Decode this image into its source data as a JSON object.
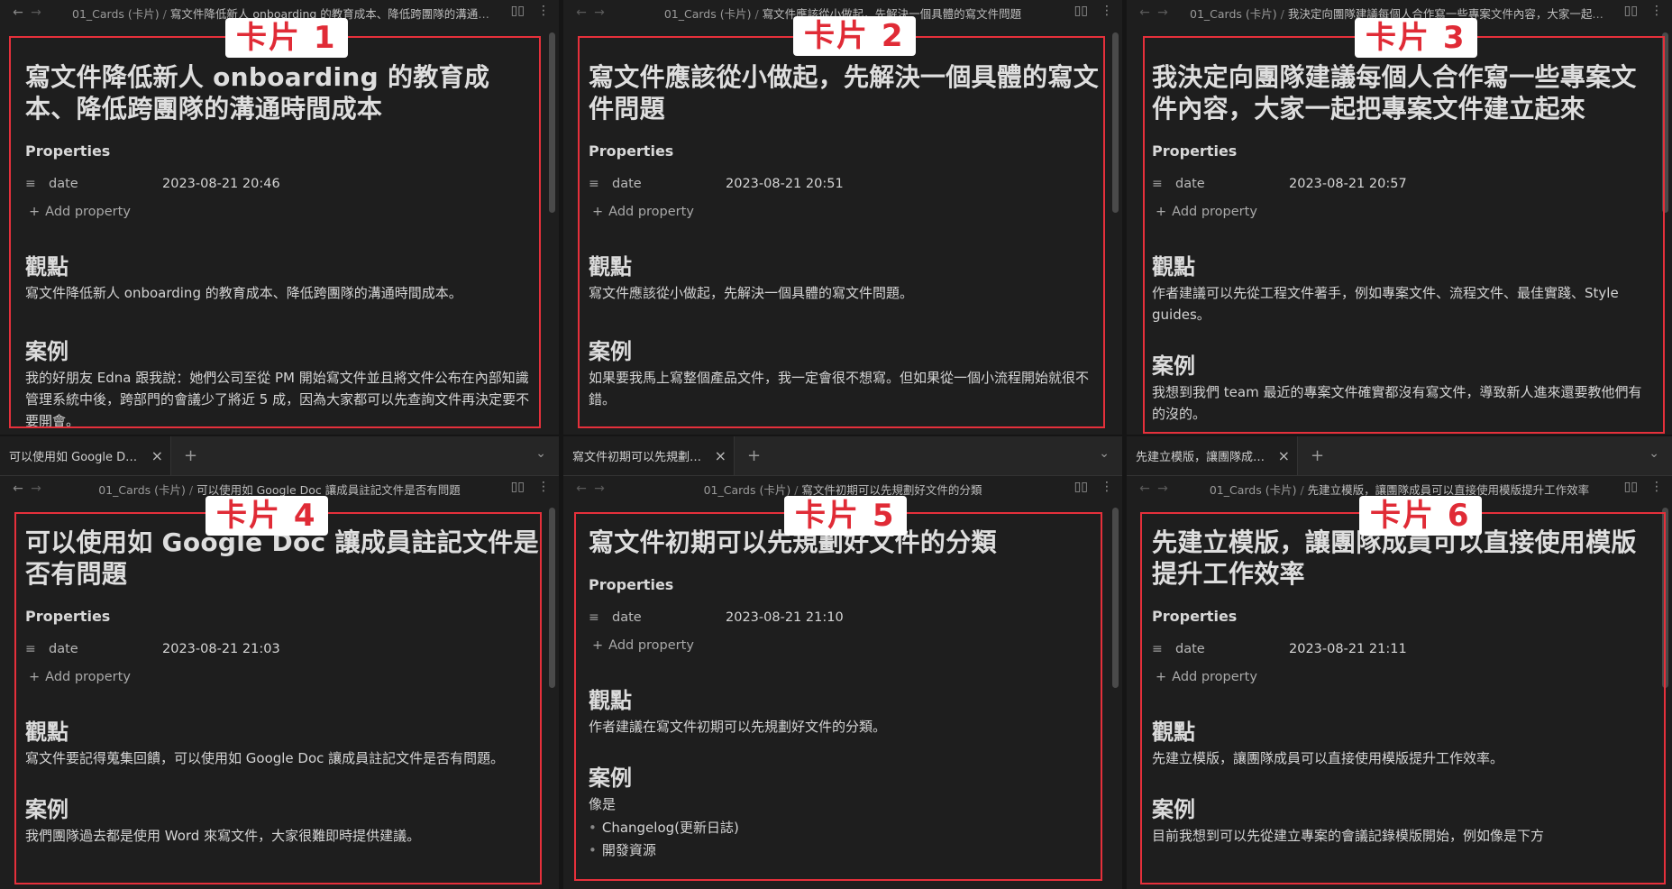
{
  "labels": {
    "properties": "Properties",
    "date_key": "date",
    "add_property": "Add property",
    "viewpoint": "觀點",
    "example": "案例"
  },
  "folder": "01_Cards (卡片)",
  "panes": [
    {
      "card_label": "卡片 1",
      "breadcrumb_file": "寫文件降低新人 onboarding 的教育成本、降低跨團隊的溝通時間成本",
      "title": "寫文件降低新人 onboarding 的教育成本、降低跨團隊的溝通時間成本",
      "date": "2023-08-21 20:46",
      "viewpoint": "寫文件降低新人 onboarding 的教育成本、降低跨團隊的溝通時間成本。",
      "example": "我的好朋友 Edna 跟我說：她們公司至從 PM 開始寫文件並且將文件公布在內部知識管理系統中後，跨部門的會議少了將近 5 成，因為大家都可以先查詢文件再決定要不要開會。"
    },
    {
      "card_label": "卡片 2",
      "breadcrumb_file": "寫文件應該從小做起，先解決一個具體的寫文件問題",
      "title": "寫文件應該從小做起，先解決一個具體的寫文件問題",
      "date": "2023-08-21 20:51",
      "viewpoint": "寫文件應該從小做起，先解決一個具體的寫文件問題。",
      "example": "如果要我馬上寫整個產品文件，我一定會很不想寫。但如果從一個小流程開始就很不錯。"
    },
    {
      "card_label": "卡片 3",
      "breadcrumb_file": "我決定向團隊建議每個人合作寫一些專案文件內容，大家一起把專案文件建立起來",
      "title": "我決定向團隊建議每個人合作寫一些專案文件內容，大家一起把專案文件建立起來",
      "date": "2023-08-21 20:57",
      "viewpoint": "作者建議可以先從工程文件著手，例如專案文件、流程文件、最佳實踐、Style guides。",
      "example": "我想到我們 team 最近的專案文件確實都沒有寫文件，導致新人進來還要教他們有的沒的。"
    },
    {
      "card_label": "卡片 4",
      "tab_title": "可以使用如 Google Doc 讓成員註記文件是否有問題",
      "breadcrumb_file": "可以使用如 Google Doc 讓成員註記文件是否有問題",
      "title": "可以使用如 Google Doc 讓成員註記文件是否有問題",
      "date": "2023-08-21 21:03",
      "viewpoint": "寫文件要記得蒐集回饋，可以使用如 Google Doc 讓成員註記文件是否有問題。",
      "example": "我們團隊過去都是使用 Word 來寫文件，大家很難即時提供建議。"
    },
    {
      "card_label": "卡片 5",
      "tab_title": "寫文件初期可以先規劃好文件的分類",
      "breadcrumb_file": "寫文件初期可以先規劃好文件的分類",
      "title": "寫文件初期可以先規劃好文件的分類",
      "date": "2023-08-21 21:10",
      "viewpoint": "作者建議在寫文件初期可以先規劃好文件的分類。",
      "example": "像是",
      "bullets": [
        "Changelog(更新日誌)",
        "開發資源"
      ]
    },
    {
      "card_label": "卡片 6",
      "tab_title": "先建立模版，讓團隊成員可以直接使用模版提升工作效率",
      "breadcrumb_file": "先建立模版，讓團隊成員可以直接使用模版提升工作效率",
      "title": "先建立模版，讓團隊成員可以直接使用模版提升工作效率",
      "date": "2023-08-21 21:11",
      "viewpoint": "先建立模版，讓團隊成員可以直接使用模版提升工作效率。",
      "example": "目前我想到可以先從建立專案的會議記錄模版開始，例如像是下方"
    }
  ],
  "colors": {
    "accent_red": "#e5303b",
    "background": "#1e1e1e"
  }
}
